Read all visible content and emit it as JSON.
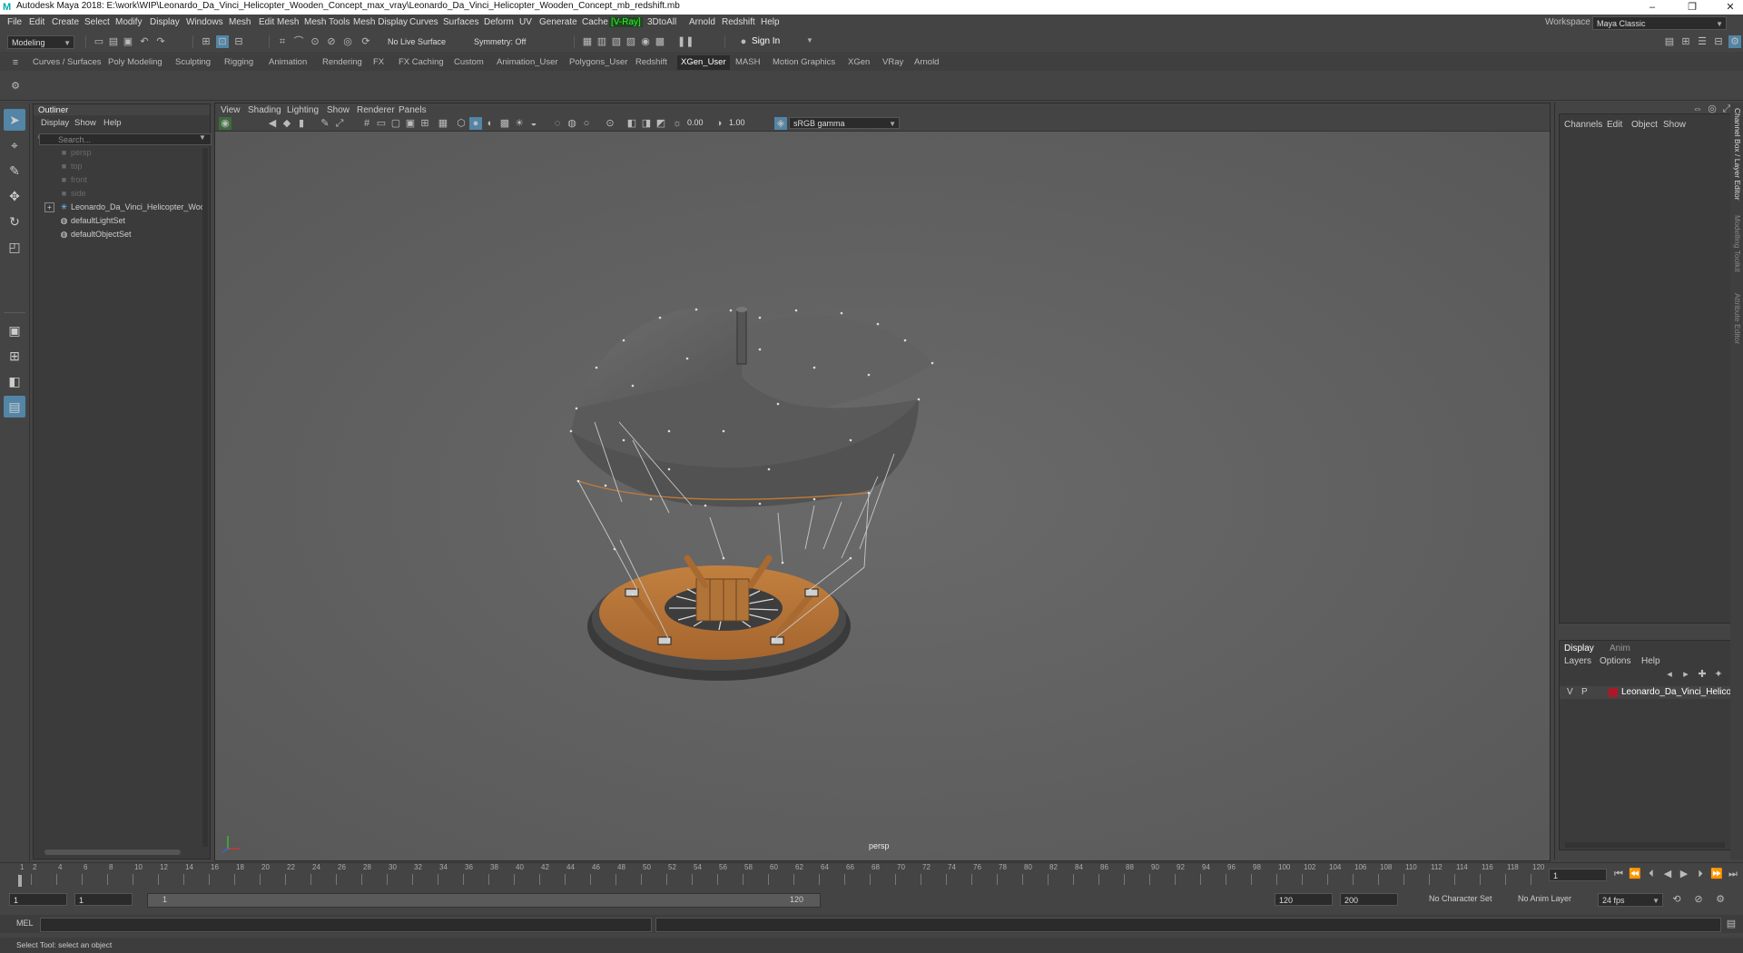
{
  "titlebar": {
    "title": "Autodesk Maya 2018: E:\\work\\WIP\\Leonardo_Da_Vinci_Helicopter_Wooden_Concept_max_vray\\Leonardo_Da_Vinci_Helicopter_Wooden_Concept_mb_redshift.mb",
    "logo": "M",
    "minimize": "–",
    "maximize": "❐",
    "close": "✕"
  },
  "menubar": {
    "items": [
      "File",
      "Edit",
      "Create",
      "Select",
      "Modify",
      "Display",
      "Windows",
      "Mesh",
      "Edit Mesh",
      "Mesh Tools",
      "Mesh Display",
      "Curves",
      "Surfaces",
      "Deform",
      "UV",
      "Generate",
      "Cache",
      "[V-Ray]",
      "3DtoAll",
      "Arnold",
      "Redshift",
      "Help"
    ],
    "workspace_label": "Workspace :",
    "workspace_value": "Maya Classic"
  },
  "toolbar": {
    "mode": "Modeling",
    "live_surface": "No Live Surface",
    "symmetry": "Symmetry: Off",
    "sign_in": "Sign In"
  },
  "shelf_tabs": [
    "Curves / Surfaces",
    "Poly Modeling",
    "Sculpting",
    "Rigging",
    "Animation",
    "Rendering",
    "FX",
    "FX Caching",
    "Custom",
    "Animation_User",
    "Polygons_User",
    "Redshift",
    "XGen_User",
    "MASH",
    "Motion Graphics",
    "XGen",
    "VRay",
    "Arnold"
  ],
  "shelf_active": "XGen_User",
  "outliner": {
    "title": "Outliner",
    "menu": [
      "Display",
      "Show",
      "Help"
    ],
    "search_placeholder": "Search...",
    "items": [
      {
        "label": "persp",
        "icon": "camera-icon",
        "dim": true
      },
      {
        "label": "top",
        "icon": "camera-icon",
        "dim": true
      },
      {
        "label": "front",
        "icon": "camera-icon",
        "dim": true
      },
      {
        "label": "side",
        "icon": "camera-icon",
        "dim": true
      },
      {
        "label": "Leonardo_Da_Vinci_Helicopter_Wooden",
        "icon": "group-icon",
        "dim": false,
        "expandable": true
      },
      {
        "label": "defaultLightSet",
        "icon": "set-icon",
        "dim": false
      },
      {
        "label": "defaultObjectSet",
        "icon": "set-icon",
        "dim": false
      }
    ]
  },
  "viewport": {
    "menu": [
      "View",
      "Shading",
      "Lighting",
      "Show",
      "Renderer",
      "Panels"
    ],
    "exposure": "0.00",
    "gamma": "1.00",
    "color_space": "sRGB gamma",
    "camera_label": "persp"
  },
  "channel_box": {
    "menu": [
      "Channels",
      "Edit",
      "Object",
      "Show"
    ]
  },
  "layer_editor": {
    "tabs": [
      "Display",
      "Anim"
    ],
    "menu": [
      "Layers",
      "Options",
      "Help"
    ],
    "layer": {
      "v": "V",
      "p": "P",
      "name": "Leonardo_Da_Vinci_Helicopter",
      "color": "#b0162a"
    }
  },
  "side_tabs": [
    "Channel Box / Layer Editor",
    "Modelling Toolkit",
    "Attribute Editor"
  ],
  "timeline": {
    "ticks": [
      "1",
      "2",
      "4",
      "6",
      "8",
      "10",
      "12",
      "14",
      "16",
      "18",
      "20",
      "22",
      "24",
      "26",
      "28",
      "30",
      "32",
      "34",
      "36",
      "38",
      "40",
      "42",
      "44",
      "46",
      "48",
      "50",
      "52",
      "54",
      "56",
      "58",
      "60",
      "62",
      "64",
      "66",
      "68",
      "70",
      "72",
      "74",
      "76",
      "78",
      "80",
      "82",
      "84",
      "86",
      "88",
      "90",
      "92",
      "94",
      "96",
      "98",
      "100",
      "102",
      "104",
      "106",
      "108",
      "110",
      "112",
      "114",
      "116",
      "118",
      "120"
    ],
    "current_frame": "1"
  },
  "range": {
    "start": "1",
    "playback_start": "1",
    "slider_start": "1",
    "slider_end": "120",
    "playback_end": "120",
    "end": "200",
    "character_set": "No Character Set",
    "anim_layer": "No Anim Layer",
    "fps": "24 fps"
  },
  "command": {
    "label": "MEL"
  },
  "help_line": "Select Tool: select an object",
  "colors": {
    "wood": "#b5733a",
    "canvas": "#6a6a6a",
    "accent": "#5285a6"
  }
}
